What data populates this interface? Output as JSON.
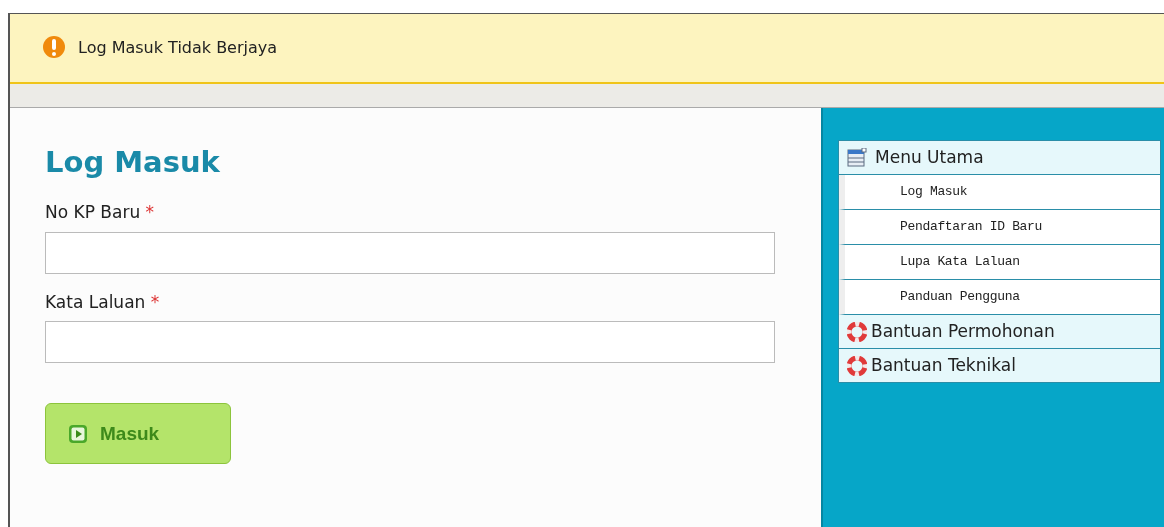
{
  "alert": {
    "message": "Log Masuk Tidak Berjaya"
  },
  "login": {
    "title": "Log Masuk",
    "fields": [
      {
        "label": "No KP Baru",
        "required_mark": "*"
      },
      {
        "label": "Kata Laluan",
        "required_mark": "*"
      }
    ],
    "button": "Masuk"
  },
  "menu": [
    {
      "kind": "header",
      "label": "Menu Utama"
    },
    {
      "kind": "link",
      "label": "Log Masuk"
    },
    {
      "kind": "link",
      "label": "Pendaftaran ID Baru"
    },
    {
      "kind": "link",
      "label": "Lupa Kata Laluan"
    },
    {
      "kind": "link",
      "label": "Panduan Pengguna"
    },
    {
      "kind": "help",
      "label": "Bantuan Permohonan"
    },
    {
      "kind": "help",
      "label": "Bantuan Teknikal"
    }
  ]
}
